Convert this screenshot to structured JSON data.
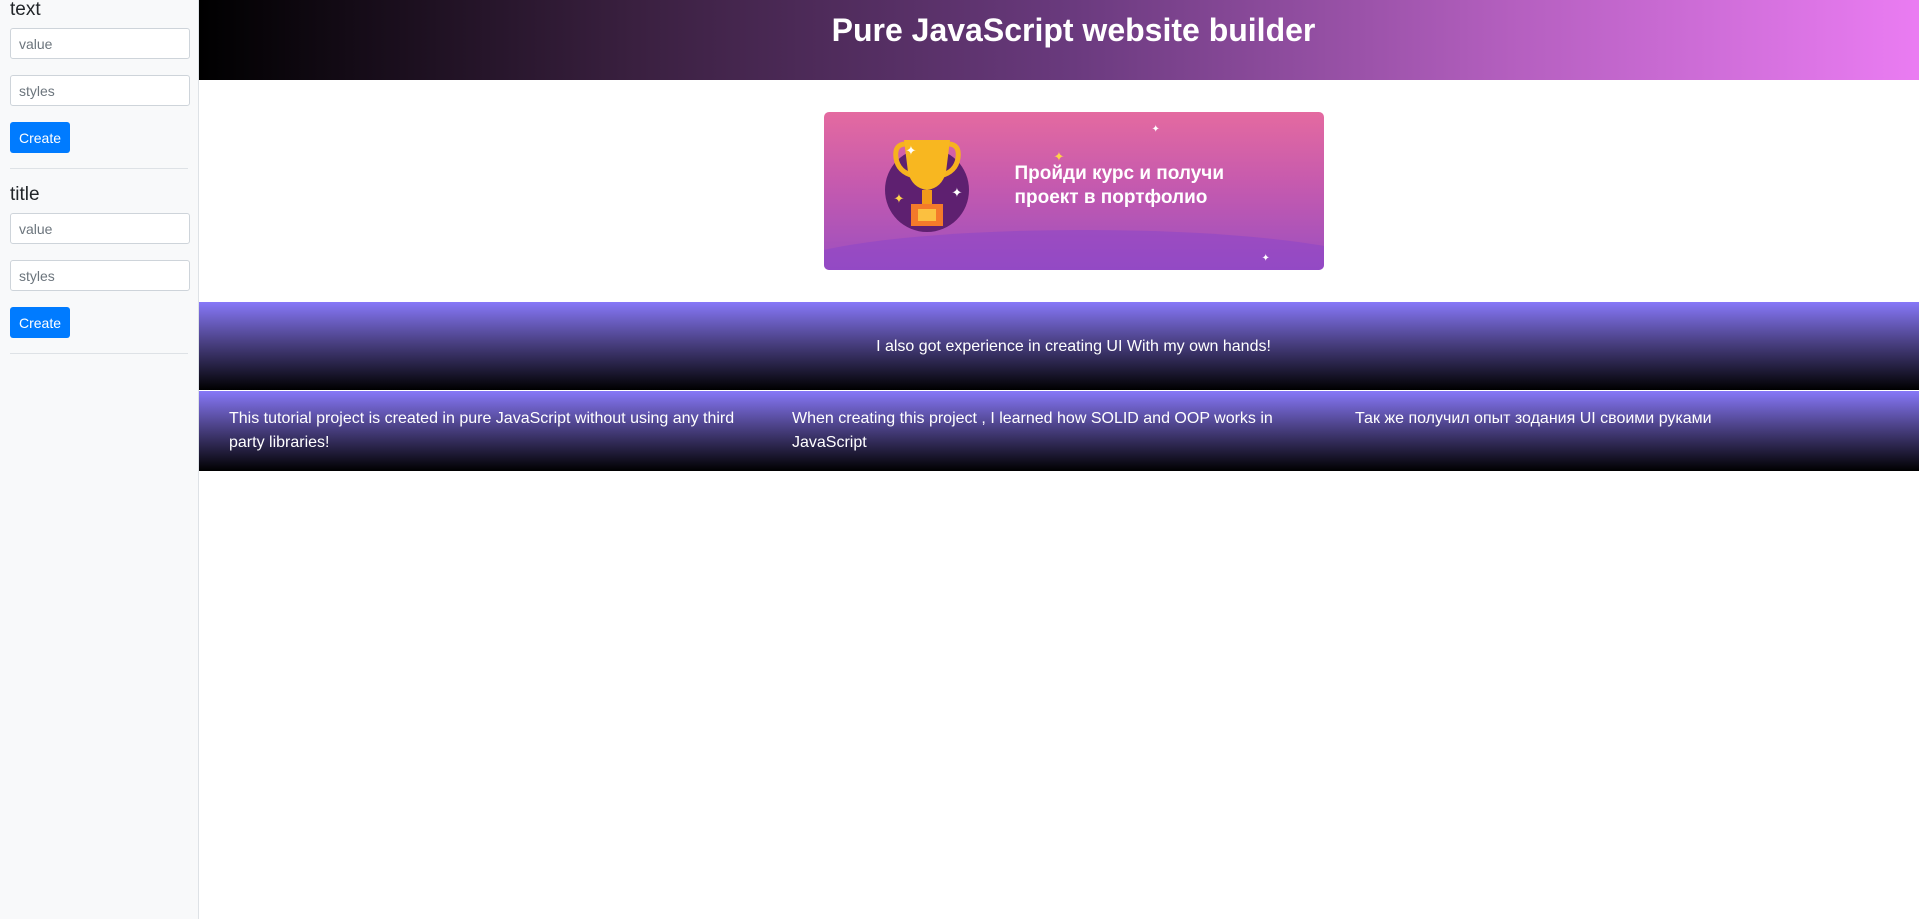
{
  "sidebar": {
    "blocks": [
      {
        "heading": "text",
        "value_placeholder": "value",
        "styles_placeholder": "styles",
        "button_label": "Create"
      },
      {
        "heading": "title",
        "value_placeholder": "value",
        "styles_placeholder": "styles",
        "button_label": "Create"
      }
    ]
  },
  "main": {
    "title": "Pure JavaScript website builder",
    "banner": {
      "line1": "Пройди курс и получи",
      "line2": "проект в портфолио"
    },
    "strip_text": "I also got experience in creating UI With my own hands!",
    "columns": [
      "This tutorial project is created in pure JavaScript without using any third party libraries!",
      "When creating this project , I learned how SOLID and OOP works in JavaScript",
      "Так же получил опыт зодания UI своими руками"
    ]
  },
  "colors": {
    "primary_button": "#007bff",
    "header_gradient_start": "#000000",
    "header_gradient_end": "#ee7ef6",
    "strip_gradient_top": "#8778f8"
  }
}
